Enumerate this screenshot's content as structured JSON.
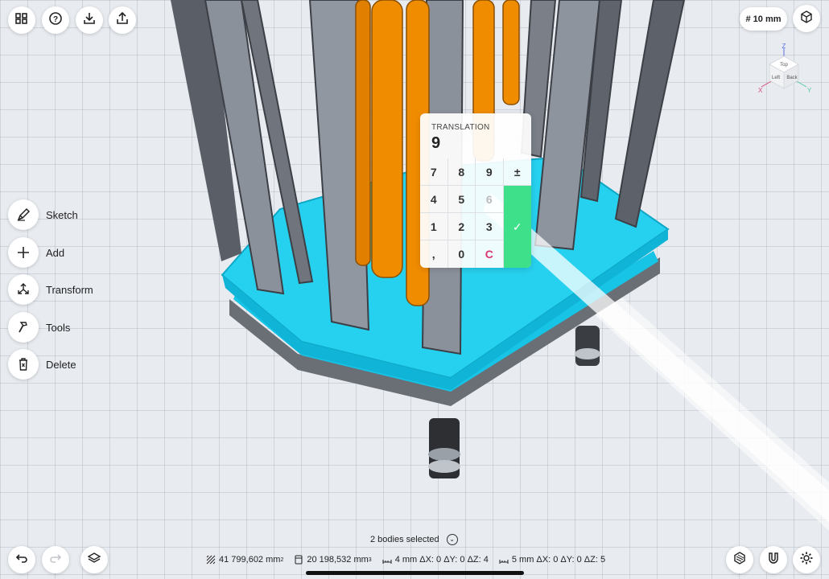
{
  "toolbar_top": {
    "left_buttons": [
      {
        "icon": "grid-icon",
        "name": "menu-button"
      },
      {
        "icon": "help-icon",
        "name": "help-button"
      },
      {
        "icon": "import-icon",
        "name": "import-button"
      },
      {
        "icon": "share-icon",
        "name": "export-button"
      }
    ],
    "grid_size": "# 10 mm",
    "view_mode_icon": "cube-wireframe-icon"
  },
  "view_cube": {
    "faces": [
      "Top",
      "Left",
      "Back"
    ],
    "axes": {
      "x": "X",
      "y": "Y",
      "z": "Z"
    },
    "colors": {
      "x": "#d64a7a",
      "y": "#59c9a5",
      "z": "#5b6ee1"
    }
  },
  "tools": [
    {
      "label": "Sketch",
      "icon": "pen-icon"
    },
    {
      "label": "Add",
      "icon": "plus-icon"
    },
    {
      "label": "Transform",
      "icon": "transform-icon"
    },
    {
      "label": "Tools",
      "icon": "hammer-icon"
    },
    {
      "label": "Delete",
      "icon": "trash-icon"
    }
  ],
  "numpad": {
    "title": "TRANSLATION",
    "value": "9",
    "keys": [
      "7",
      "8",
      "9",
      "±",
      "4",
      "5",
      "6",
      "1",
      "2",
      "3",
      ",",
      "0",
      "C"
    ],
    "confirm_icon": "check-icon"
  },
  "selection": {
    "text": "2 bodies selected"
  },
  "stats": {
    "area": "41 799,602 mm",
    "area_unit_sup": "2",
    "volume": "20 198,532 mm",
    "volume_unit_sup": "3",
    "measure1": "4 mm  ΔX: 0  ΔY: 0 ΔZ: 4",
    "measure2": "5 mm  ΔX: 0  ΔY: 0 ΔZ: 5"
  },
  "bottom_buttons": {
    "left": [
      {
        "icon": "undo-icon"
      },
      {
        "icon": "redo-icon"
      },
      {
        "icon": "layers-icon"
      }
    ],
    "right": [
      {
        "icon": "render-mode-icon"
      },
      {
        "icon": "magnet-icon"
      },
      {
        "icon": "gear-icon"
      }
    ]
  },
  "colors": {
    "accent_cyan": "#18c4e6",
    "rod_orange": "#f08c00",
    "bar_gray": "#8b919b",
    "confirm_green": "#3fe08a",
    "clear_pink": "#d9366f"
  }
}
